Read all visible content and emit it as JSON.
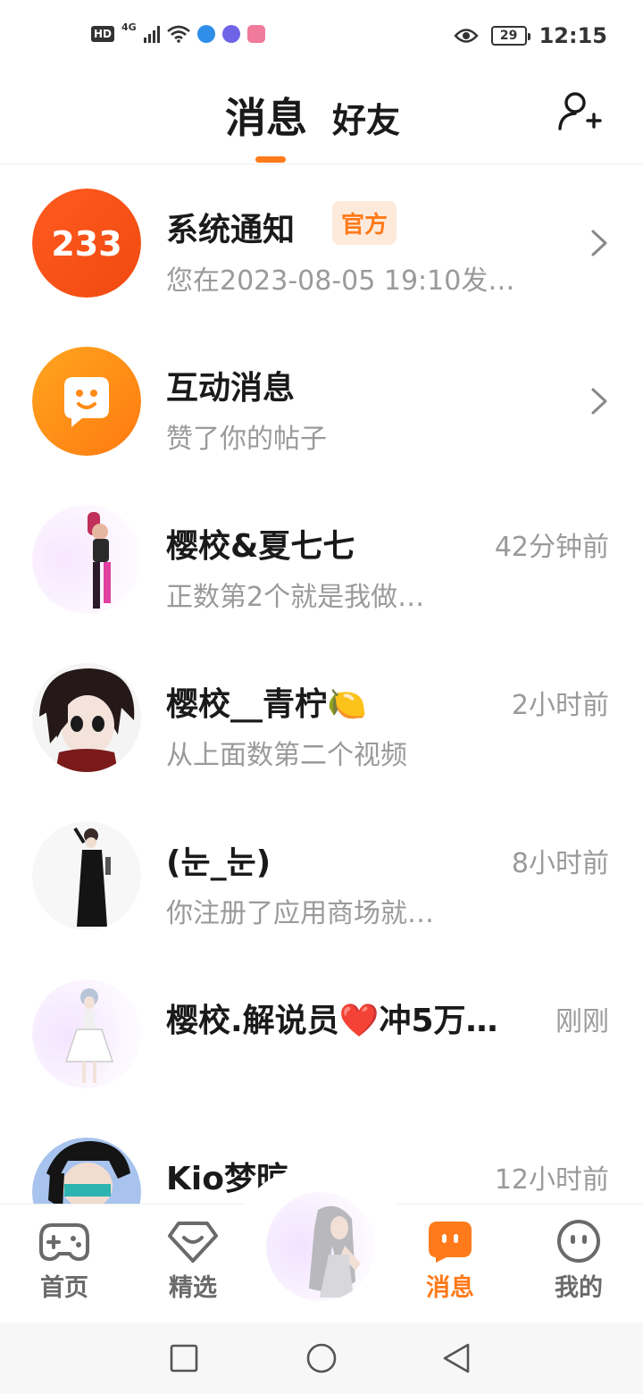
{
  "status_bar": {
    "hd": "HD",
    "network": "4G",
    "battery": "29",
    "time": "12:15",
    "app_icon_colors": [
      "#2f8fe8",
      "#6f63e8",
      "#f07a9a"
    ]
  },
  "header": {
    "tab_messages": "消息",
    "tab_friends": "好友",
    "accent_color": "#ff7a1a"
  },
  "conversations": [
    {
      "name": "系统通知",
      "badge": "官方",
      "message": "您在2023-08-05 19:10发…",
      "time": "",
      "avatar_text": "233"
    },
    {
      "name": "互动消息",
      "message": "赞了你的帖子",
      "time": ""
    },
    {
      "name": "樱校&夏七七",
      "message": "正数第2个就是我做…",
      "time": "42分钟前"
    },
    {
      "name": "樱校__青柠🍋",
      "message": "从上面数第二个视频",
      "time": "2小时前"
    },
    {
      "name": "(눈_눈)",
      "message": "你注册了应用商场就…",
      "time": "8小时前"
    },
    {
      "name": "樱校.解说员❤️冲5万…",
      "message": "",
      "time": "刚刚"
    },
    {
      "name": "Kio梦晾",
      "message": "",
      "time": "12小时前"
    }
  ],
  "bottom_nav": {
    "home": "首页",
    "featured": "精选",
    "messages": "消息",
    "mine": "我的"
  }
}
